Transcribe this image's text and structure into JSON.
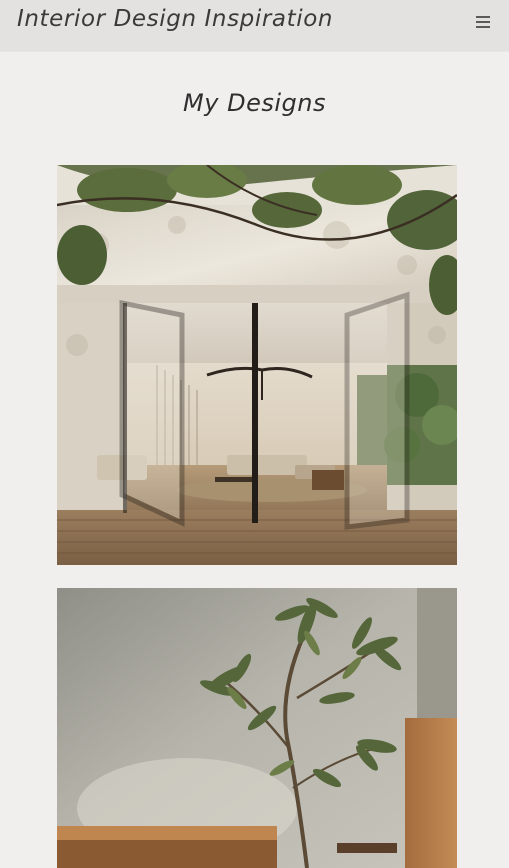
{
  "header": {
    "site_title": "Interior Design Inspiration",
    "menu_icon": "hamburger-menu-icon"
  },
  "main": {
    "page_title": "My Designs",
    "gallery": [
      {
        "image": "photo of a bright interior with glass pivot doors opening onto a wooden deck, foliage in foreground"
      },
      {
        "image": "photo of a potted tree in a softly lit room with a wooden bench"
      }
    ]
  },
  "colors": {
    "background": "#f1eeee",
    "header_background": "#e4e1e1",
    "text": "#333333"
  }
}
